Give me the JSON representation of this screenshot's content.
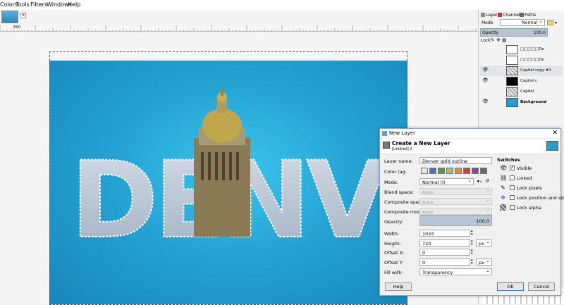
{
  "menu": {
    "colors": "Colors",
    "tools": "Tools",
    "filters": "Filters",
    "windows": "Windows",
    "help": "Help"
  },
  "image_tab": {
    "close": "×"
  },
  "ruler": {
    "label": "|500"
  },
  "canvas": {
    "word": "DENVER"
  },
  "layers_panel": {
    "tabs": {
      "layers": "Layers",
      "channels": "Channels",
      "paths": "Paths"
    },
    "mode_label": "Mode",
    "mode_value": "Normal",
    "opacity_label": "Opacity",
    "opacity_value": "100.0",
    "lock_label": "Lock:",
    "layers": [
      {
        "name": "□□□□□De",
        "visible": false
      },
      {
        "name": "□□□□□De",
        "visible": false
      },
      {
        "name": "Capitol copy #1",
        "visible": true
      },
      {
        "name": "Capitol c",
        "visible": true
      },
      {
        "name": "Capitol",
        "visible": false
      },
      {
        "name": "Background",
        "visible": true
      }
    ]
  },
  "dialog": {
    "window_title": "New Layer",
    "heading": "Create a New Layer",
    "subheading": "[Untitled]-2",
    "fields": {
      "layer_name": {
        "label": "Layer name:",
        "value": "Denver gold outline"
      },
      "color_tag": {
        "label": "Color tag:"
      },
      "mode": {
        "label": "Mode:",
        "value": "Normal (l)"
      },
      "blend_space": {
        "label": "Blend space:",
        "value": "Auto"
      },
      "composite_space": {
        "label": "Composite space:",
        "value": "Auto"
      },
      "composite_mode": {
        "label": "Composite mode:",
        "value": "Auto"
      },
      "opacity": {
        "label": "Opacity:",
        "value": "100.0"
      },
      "width": {
        "label": "Width:",
        "value": "1024"
      },
      "height": {
        "label": "Height:",
        "value": "720"
      },
      "unit": "px",
      "offset_x": {
        "label": "Offset X:",
        "value": "0"
      },
      "offset_y": {
        "label": "Offset Y:",
        "value": "0"
      },
      "fill_with": {
        "label": "Fill with:",
        "value": "Transparency"
      }
    },
    "color_tags": [
      "#e6e6e6",
      "#4f6fc2",
      "#5b9b3c",
      "#c7b63a",
      "#e58a3a",
      "#c94532",
      "#8b4a8f",
      "#6a6a6a"
    ],
    "switches": {
      "title": "Switches",
      "visible": {
        "label": "Visible",
        "checked": true
      },
      "linked": {
        "label": "Linked",
        "checked": false
      },
      "lock_pixels": {
        "label": "Lock pixels",
        "checked": false
      },
      "lock_position": {
        "label": "Lock position and size",
        "checked": false
      },
      "lock_alpha": {
        "label": "Lock alpha",
        "checked": false
      }
    },
    "buttons": {
      "help": "Help",
      "ok": "OK",
      "cancel": "Cancel"
    }
  }
}
